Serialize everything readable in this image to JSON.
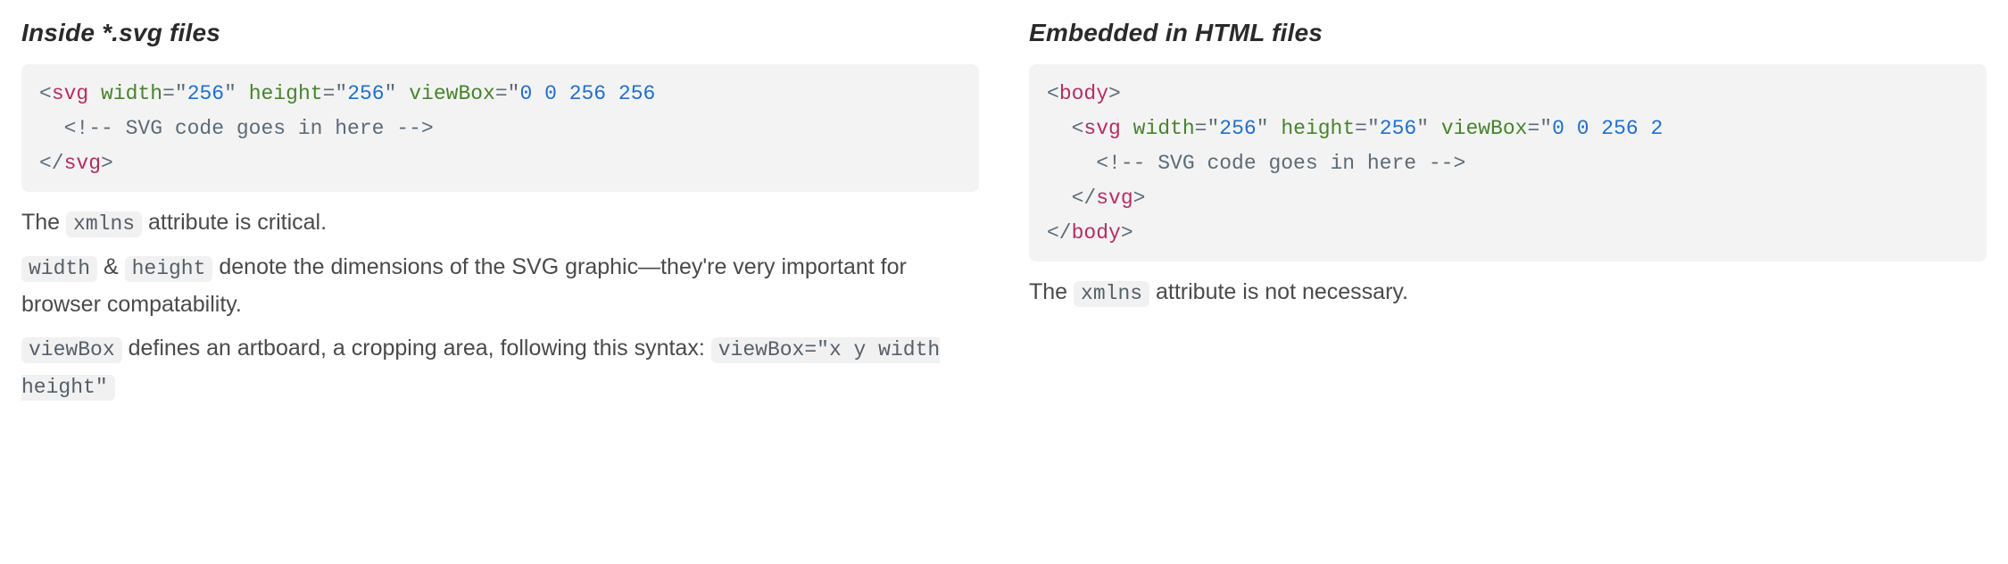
{
  "left": {
    "heading": "Inside *.svg files",
    "code": {
      "tag_svg": "svg",
      "attr_width_name": "width",
      "attr_width_q": "\"",
      "attr_width_val": "256",
      "attr_height_name": "height",
      "attr_height_val": "256",
      "attr_viewbox_name": "viewBox",
      "attr_viewbox_val": "0 0 256 256",
      "comment": "<!-- SVG code goes in here -->",
      "close_svg": "svg"
    },
    "desc": {
      "p1_pre": "The ",
      "p1_code": "xmlns",
      "p1_post": " attribute is critical.",
      "p2_code1": "width",
      "p2_amp": " & ",
      "p2_code2": "height",
      "p2_post": " denote the dimensions of the SVG graphic—they're very important for browser compatability.",
      "p3_code": "viewBox",
      "p3_post": " defines an artboard, a cropping area, following this syntax: ",
      "p3_code2": "viewBox=\"x y width height\""
    }
  },
  "right": {
    "heading": "Embedded in HTML files",
    "code": {
      "tag_body": "body",
      "tag_svg": "svg",
      "attr_width_name": "width",
      "attr_width_val": "256",
      "attr_height_name": "height",
      "attr_height_val": "256",
      "attr_viewbox_name": "viewBox",
      "attr_viewbox_val": "0 0 256 2",
      "comment": "<!-- SVG code goes in here -->",
      "close_svg": "svg",
      "close_body": "body"
    },
    "desc": {
      "p1_pre": "The ",
      "p1_code": "xmlns",
      "p1_post": " attribute is not necessary."
    }
  }
}
